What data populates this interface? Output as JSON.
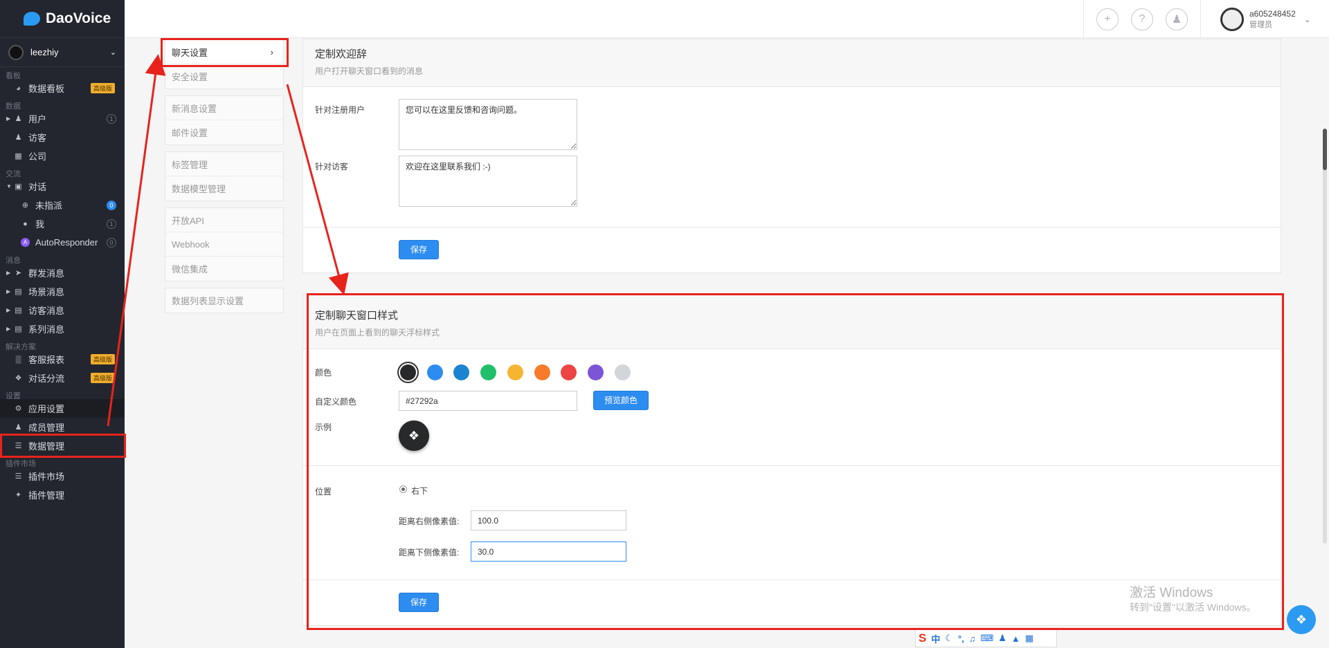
{
  "brand": {
    "name": "DaoVoice"
  },
  "user": {
    "name": "leezhiy"
  },
  "sidebar": {
    "sections": [
      {
        "label": "看板"
      },
      {
        "label": "数据"
      },
      {
        "label": "交流"
      },
      {
        "label": "消息"
      },
      {
        "label": "解决方案"
      },
      {
        "label": "设置"
      },
      {
        "label": "插件市场"
      }
    ],
    "items": {
      "dashboard": {
        "label": "数据看板",
        "badge": "高级版"
      },
      "users": {
        "label": "用户",
        "count": "1"
      },
      "visitors": {
        "label": "访客"
      },
      "company": {
        "label": "公司"
      },
      "conversations": {
        "label": "对话"
      },
      "unassigned": {
        "label": "未指派",
        "count": "0"
      },
      "me": {
        "label": "我",
        "count": "1"
      },
      "autoresponder": {
        "label": "AutoResponder",
        "count": "0"
      },
      "broadcast": {
        "label": "群发消息"
      },
      "scene": {
        "label": "场景消息"
      },
      "visitor_msg": {
        "label": "访客消息"
      },
      "series": {
        "label": "系列消息"
      },
      "service_report": {
        "label": "客服报表",
        "badge": "高级版"
      },
      "routing": {
        "label": "对话分流",
        "badge": "高级版"
      },
      "app_settings": {
        "label": "应用设置"
      },
      "members": {
        "label": "成员管理"
      },
      "data_mgmt": {
        "label": "数据管理"
      },
      "plugin_market": {
        "label": "插件市场"
      },
      "plugin_mgmt": {
        "label": "插件管理"
      }
    }
  },
  "topbar": {
    "account": "a605248452",
    "role": "管理员"
  },
  "settings_menu": {
    "chat": "聊天设置",
    "security": "安全设置",
    "new_msg": "新消息设置",
    "mail": "邮件设置",
    "tags": "标签管理",
    "data_model": "数据模型管理",
    "api": "开放API",
    "webhook": "Webhook",
    "wechat": "微信集成",
    "list_display": "数据列表显示设置"
  },
  "welcome": {
    "title": "定制欢迎辞",
    "subtitle": "用户打开聊天窗口看到的消息",
    "registered_label": "针对注册用户",
    "registered_value": "您可以在这里反馈和咨询问题。",
    "visitor_label": "针对访客",
    "visitor_value": "欢迎在这里联系我们 :-)",
    "save": "保存"
  },
  "style": {
    "title": "定制聊天窗口样式",
    "subtitle": "用户在页面上看到的聊天浮标样式",
    "color_label": "颜色",
    "colors": [
      "#27292a",
      "#2d8cf0",
      "#1b84d0",
      "#21bf6b",
      "#f5b533",
      "#f77b2b",
      "#ee4444",
      "#7c55d6",
      "#d2d5da"
    ],
    "custom_color_label": "自定义颜色",
    "custom_color_value": "#27292a",
    "preview_button": "预览颜色",
    "sample_label": "示例",
    "position_label": "位置",
    "position_option": "右下",
    "right_label": "距离右侧像素值:",
    "right_value": "100.0",
    "bottom_label": "距离下侧像素值:",
    "bottom_value": "30.0",
    "save": "保存"
  },
  "watermark": {
    "line1": "激活 Windows",
    "line2": "转到\"设置\"以激活 Windows。"
  },
  "ime": {
    "label": "中"
  }
}
